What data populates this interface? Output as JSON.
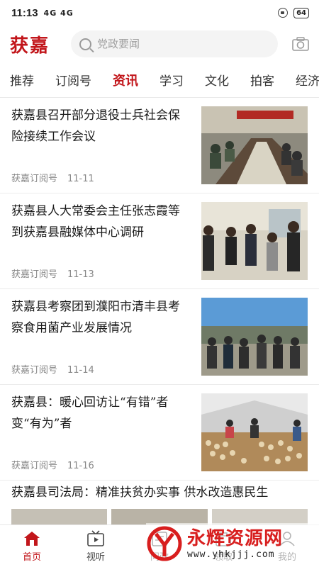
{
  "status_bar": {
    "time": "11:13",
    "signals": "4G 4G",
    "battery": "64"
  },
  "header": {
    "logo": "获嘉",
    "search_placeholder": "党政要闻",
    "icons": [
      "search-icon",
      "camera-icon"
    ]
  },
  "tabs": [
    {
      "label": "推荐"
    },
    {
      "label": "订阅号"
    },
    {
      "label": "资讯",
      "active": true
    },
    {
      "label": "学习"
    },
    {
      "label": "文化"
    },
    {
      "label": "拍客"
    },
    {
      "label": "经济"
    }
  ],
  "news": [
    {
      "title": "获嘉县召开部分退役士兵社会保险接续工作会议",
      "source": "获嘉订阅号",
      "date": "11-11"
    },
    {
      "title": "获嘉县人大常委会主任张志霞等到获嘉县融媒体中心调研",
      "source": "获嘉订阅号",
      "date": "11-13"
    },
    {
      "title": "获嘉县考察团到濮阳市清丰县考察食用菌产业发展情况",
      "source": "获嘉订阅号",
      "date": "11-14"
    },
    {
      "title": "获嘉县：暖心回访让“有错”者变“有为”者",
      "source": "获嘉订阅号",
      "date": "11-16"
    },
    {
      "title": "获嘉县司法局：精准扶贫办实事 供水改造惠民生"
    }
  ],
  "bottom_nav": [
    {
      "label": "首页",
      "icon": "home-icon",
      "active": true
    },
    {
      "label": "视听",
      "icon": "tv-icon"
    },
    {
      "label": "问政",
      "icon": "inquiry-icon"
    },
    {
      "label": "领取",
      "icon": "receive-icon"
    },
    {
      "label": "我的",
      "icon": "profile-icon"
    }
  ],
  "watermark": {
    "text": "永辉资源网",
    "url": "www.yhkjjj.com"
  },
  "colors": {
    "brand": "#c2161b"
  }
}
